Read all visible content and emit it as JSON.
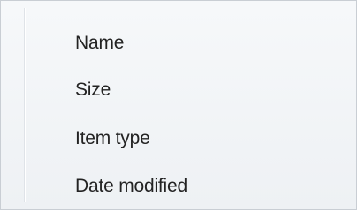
{
  "context_menu": {
    "items": [
      {
        "label": "Name"
      },
      {
        "label": "Size"
      },
      {
        "label": "Item type"
      },
      {
        "label": "Date modified"
      }
    ]
  }
}
